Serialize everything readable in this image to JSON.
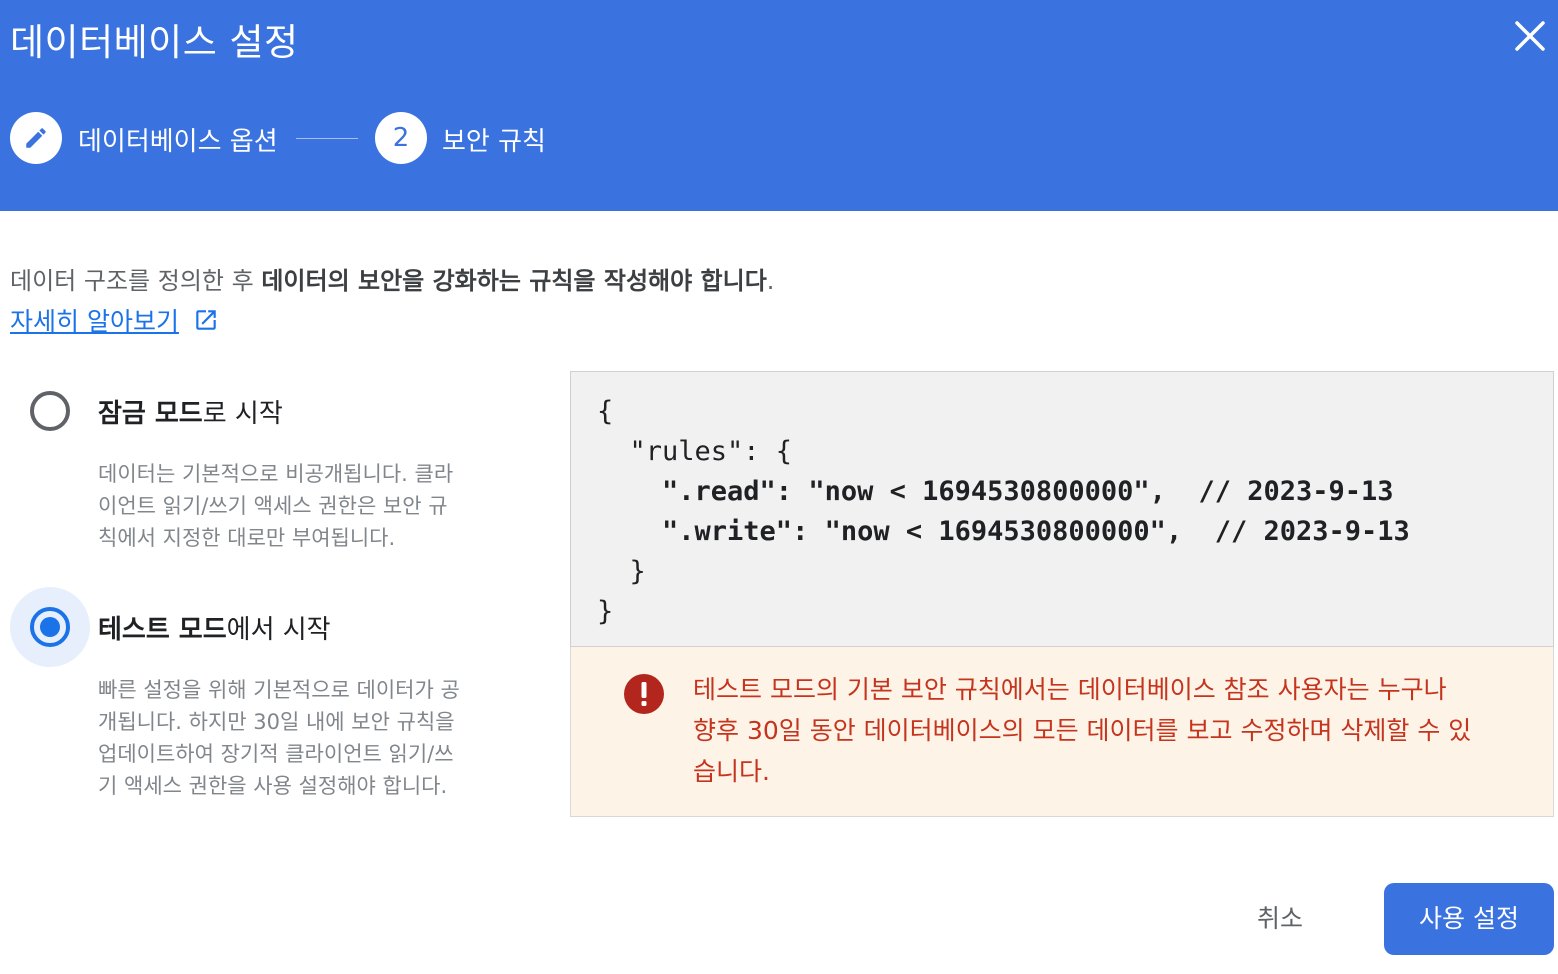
{
  "dialog": {
    "title": "데이터베이스 설정",
    "close_icon": "close-icon"
  },
  "stepper": {
    "steps": [
      {
        "label": "데이터베이스 옵션",
        "icon": "edit-pencil-icon",
        "state": "completed"
      },
      {
        "number": "2",
        "label": "보안 규칙",
        "state": "active"
      }
    ]
  },
  "intro": {
    "text_plain": "데이터 구조를 정의한 후 ",
    "text_bold": "데이터의 보안을 강화하는 규칙을 작성해야 합니다",
    "text_end": ".",
    "learn_more": "자세히 알아보기",
    "learn_more_icon": "external-link-icon"
  },
  "options": [
    {
      "title_bold": "잠금 모드",
      "title_rest": "로 시작",
      "selected": false,
      "description_lines": [
        "데이터는 기본적으로 비공개됩니다. 클라",
        "이언트 읽기/쓰기 액세스 권한은 보안 규",
        "칙에서 지정한 대로만 부여됩니다."
      ]
    },
    {
      "title_bold": "테스트 모드",
      "title_rest": "에서 시작",
      "selected": true,
      "description_lines": [
        "빠른 설정을 위해 기본적으로 데이터가 공",
        "개됩니다. 하지만 30일 내에 보안 규칙을",
        "업데이트하여 장기적 클라이언트 읽기/쓰",
        "기 액세스 권한을 사용 설정해야 합니다."
      ]
    }
  ],
  "rules_code": {
    "line1": "{",
    "line2": "  \"rules\": {",
    "line3": "    \".read\": \"now < 1694530800000\",  // 2023-9-13",
    "line4": "    \".write\": \"now < 1694530800000\",  // 2023-9-13",
    "line5": "  }",
    "line6": "}"
  },
  "warning": {
    "icon": "error-exclamation-icon",
    "lines": [
      "테스트 모드의 기본 보안 규칙에서는 데이터베이스 참조 사용자는 누구나",
      "향후 30일 동안 데이터베이스의 모든 데이터를 보고 수정하며 삭제할 수 있",
      "습니다."
    ],
    "color": "#c5341e",
    "background": "#fdf3e6"
  },
  "actions": {
    "cancel": "취소",
    "enable": "사용 설정"
  },
  "colors": {
    "header": "#3a72e0",
    "accent": "#1a73e8"
  }
}
